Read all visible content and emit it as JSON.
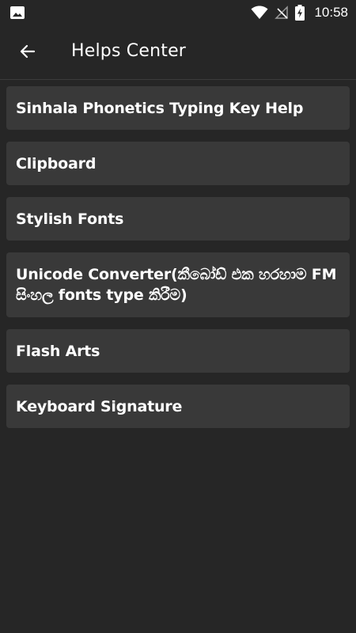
{
  "status_bar": {
    "time": "10:58",
    "icons": [
      "image-icon",
      "wifi-icon",
      "no-signal-icon",
      "battery-charging-icon"
    ]
  },
  "app_bar": {
    "back_icon": "arrow-left-icon",
    "title": "Helps Center"
  },
  "menu": {
    "items": [
      {
        "label": "Sinhala Phonetics Typing Key Help"
      },
      {
        "label": "Clipboard"
      },
      {
        "label": "Stylish Fonts"
      },
      {
        "label": "Unicode Converter(කීබෝඩ් එක හරහාම FM සිංහල fonts type කිරීම)"
      },
      {
        "label": "Flash Arts"
      },
      {
        "label": "Keyboard Signature"
      }
    ]
  },
  "colors": {
    "background": "#262626",
    "card": "#393939",
    "text": "#ffffff"
  }
}
